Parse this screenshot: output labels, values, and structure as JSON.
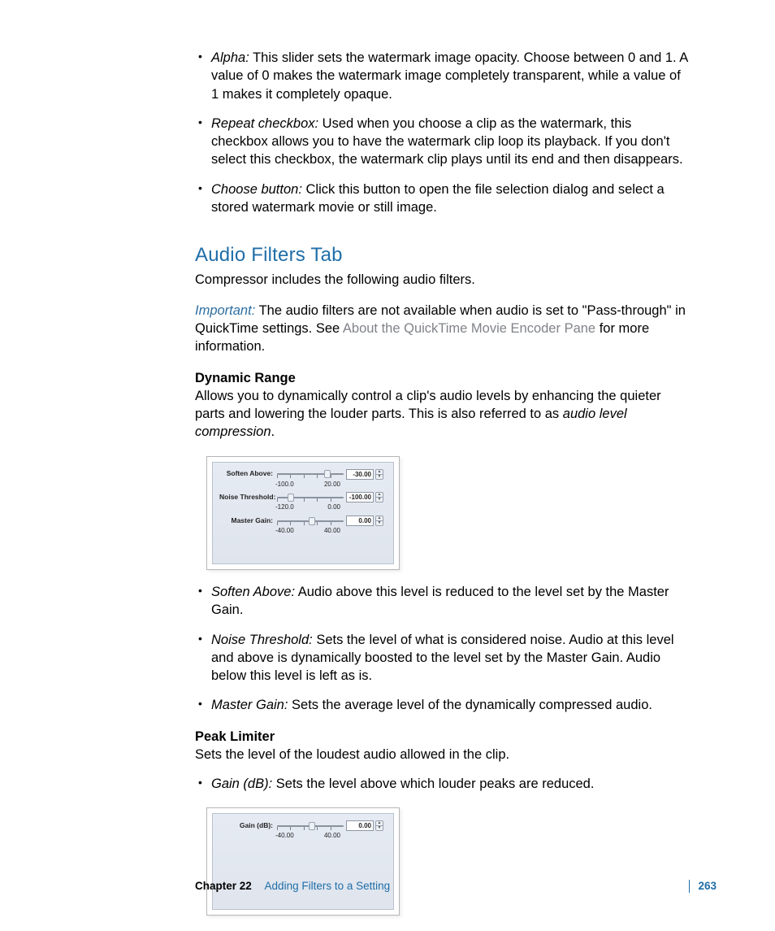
{
  "bullets_top": [
    {
      "term": "Alpha:",
      "text": " This slider sets the watermark image opacity. Choose between 0 and 1. A value of 0 makes the watermark image completely transparent, while a value of 1 makes it completely opaque."
    },
    {
      "term": "Repeat checkbox:",
      "text": " Used when you choose a clip as the watermark, this checkbox allows you to have the watermark clip loop its playback. If you don't select this checkbox, the watermark clip plays until its end and then disappears."
    },
    {
      "term": "Choose button:",
      "text": " Click this button to open the file selection dialog and select a stored watermark movie or still image."
    }
  ],
  "heading": "Audio Filters Tab",
  "lead": "Compressor includes the following audio filters.",
  "important_label": "Important:",
  "important_text_a": " The audio filters are not available when audio is set to \"Pass-through\" in QuickTime settings. See ",
  "important_link": "About the QuickTime Movie Encoder Pane",
  "important_text_b": " for more information.",
  "dr_head": "Dynamic Range",
  "dr_body_a": "Allows you to dynamically control a clip's audio levels by enhancing the quieter parts and lowering the louder parts. This is also referred to as ",
  "dr_body_em": "audio level compression",
  "dr_body_b": ".",
  "panel1": {
    "rows": [
      {
        "label": "Soften Above:",
        "value": "-30.00",
        "min": "-100.0",
        "max": "20.00",
        "thumb": 58
      },
      {
        "label": "Noise Threshold:",
        "value": "-100.00",
        "min": "-120.0",
        "max": "0.00",
        "thumb": 13
      },
      {
        "label": "Master Gain:",
        "value": "0.00",
        "min": "-40.00",
        "max": "40.00",
        "thumb": 39
      }
    ]
  },
  "dr_bullets": [
    {
      "term": "Soften Above:",
      "text": " Audio above this level is reduced to the level set by the Master Gain."
    },
    {
      "term": "Noise Threshold:",
      "text": " Sets the level of what is considered noise. Audio at this level and above is dynamically boosted to the level set by the Master Gain. Audio below this level is left as is."
    },
    {
      "term": "Master Gain:",
      "text": " Sets the average level of the dynamically compressed audio."
    }
  ],
  "pl_head": "Peak Limiter",
  "pl_body": "Sets the level of the loudest audio allowed in the clip.",
  "pl_bullets": [
    {
      "term": "Gain (dB):",
      "text": " Sets the level above which louder peaks are reduced."
    }
  ],
  "panel2": {
    "rows": [
      {
        "label": "Gain (dB):",
        "value": "0.00",
        "min": "-40.00",
        "max": "40.00",
        "thumb": 39
      }
    ]
  },
  "footer": {
    "chapter": "Chapter 22",
    "title": "Adding Filters to a Setting",
    "page": "263"
  }
}
